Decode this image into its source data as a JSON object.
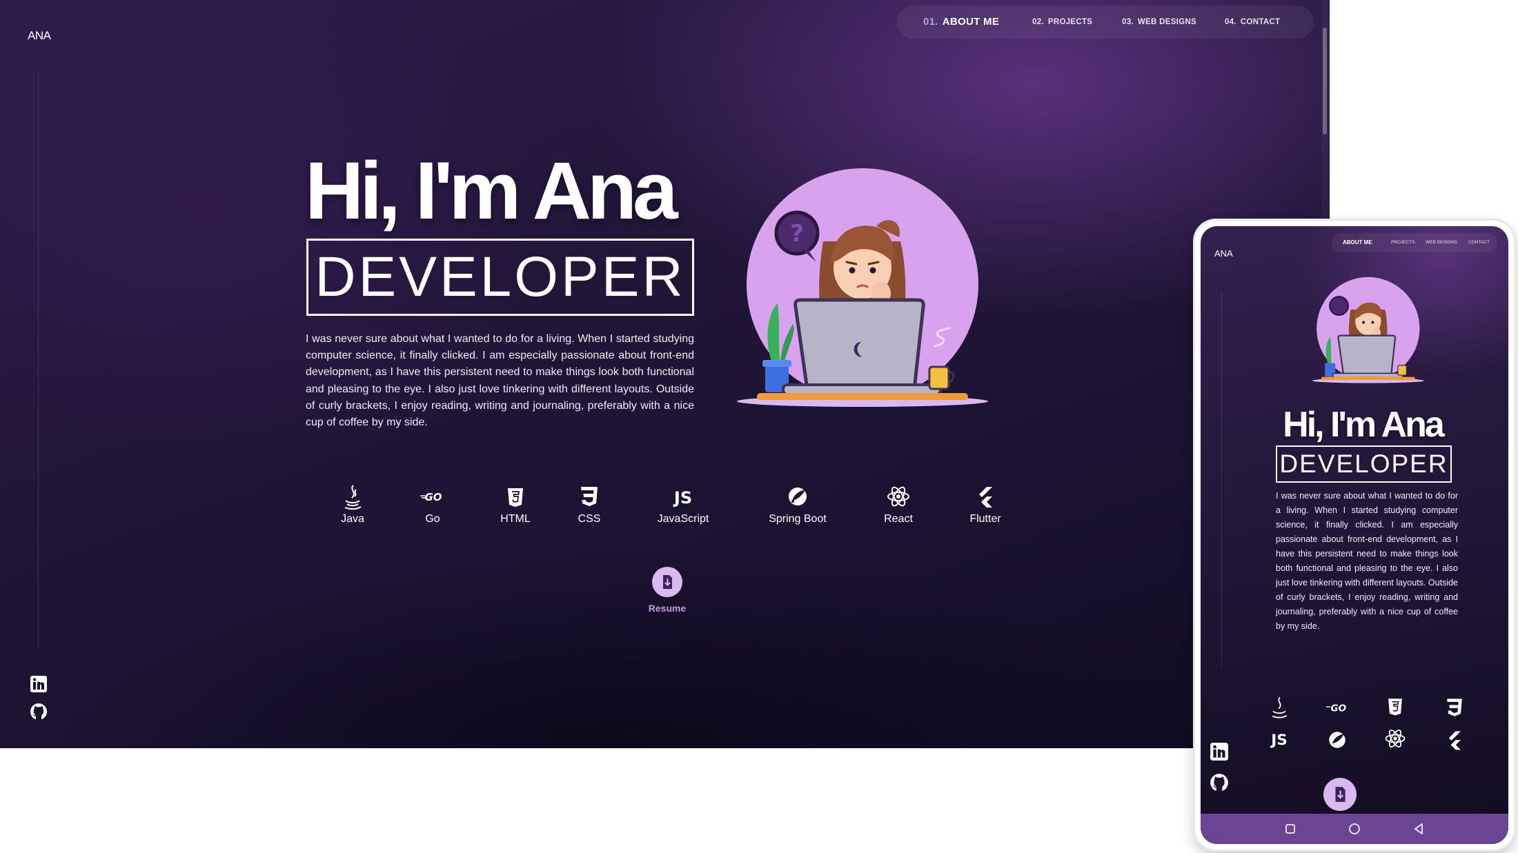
{
  "site": {
    "logo": "ANA",
    "nav": [
      {
        "num": "01.",
        "label": "ABOUT ME",
        "active": true
      },
      {
        "num": "02.",
        "label": "PROJECTS",
        "active": false
      },
      {
        "num": "03.",
        "label": "WEB DESIGNS",
        "active": false
      },
      {
        "num": "04.",
        "label": "CONTACT",
        "active": false
      }
    ],
    "hero": {
      "title": "Hi, I'm Ana",
      "role": "DEVELOPER",
      "bio": "I was never sure about what I wanted to do for a living. When I started studying computer science, it finally clicked. I am especially passionate about front-end development, as I have this persistent need to make things look both functional and pleasing to the eye. I also just love tinkering with different layouts. Outside of curly brackets, I enjoy reading, writing and journaling, preferably with a nice cup of coffee by my side."
    },
    "skills": [
      {
        "label": "Java",
        "icon": "java-icon"
      },
      {
        "label": "Go",
        "icon": "go-icon"
      },
      {
        "label": "HTML",
        "icon": "html5-icon"
      },
      {
        "label": "CSS",
        "icon": "css3-icon"
      },
      {
        "label": "JavaScript",
        "icon": "js-icon"
      },
      {
        "label": "Spring Boot",
        "icon": "spring-icon"
      },
      {
        "label": "React",
        "icon": "react-icon"
      },
      {
        "label": "Flutter",
        "icon": "flutter-icon"
      }
    ],
    "resume": {
      "label": "Resume",
      "icon": "download-file-icon"
    },
    "social": [
      {
        "name": "linkedin-icon"
      },
      {
        "name": "github-icon"
      }
    ]
  },
  "phone_nav_buttons": [
    "recent-apps-icon",
    "home-icon",
    "back-icon"
  ],
  "colors": {
    "accent": "#d9b9ef",
    "resume_label": "#c49be2",
    "illustration_circle": "#d8a2ee",
    "phone_navbar": "#6a4593",
    "background_dark": "#1a1230"
  }
}
